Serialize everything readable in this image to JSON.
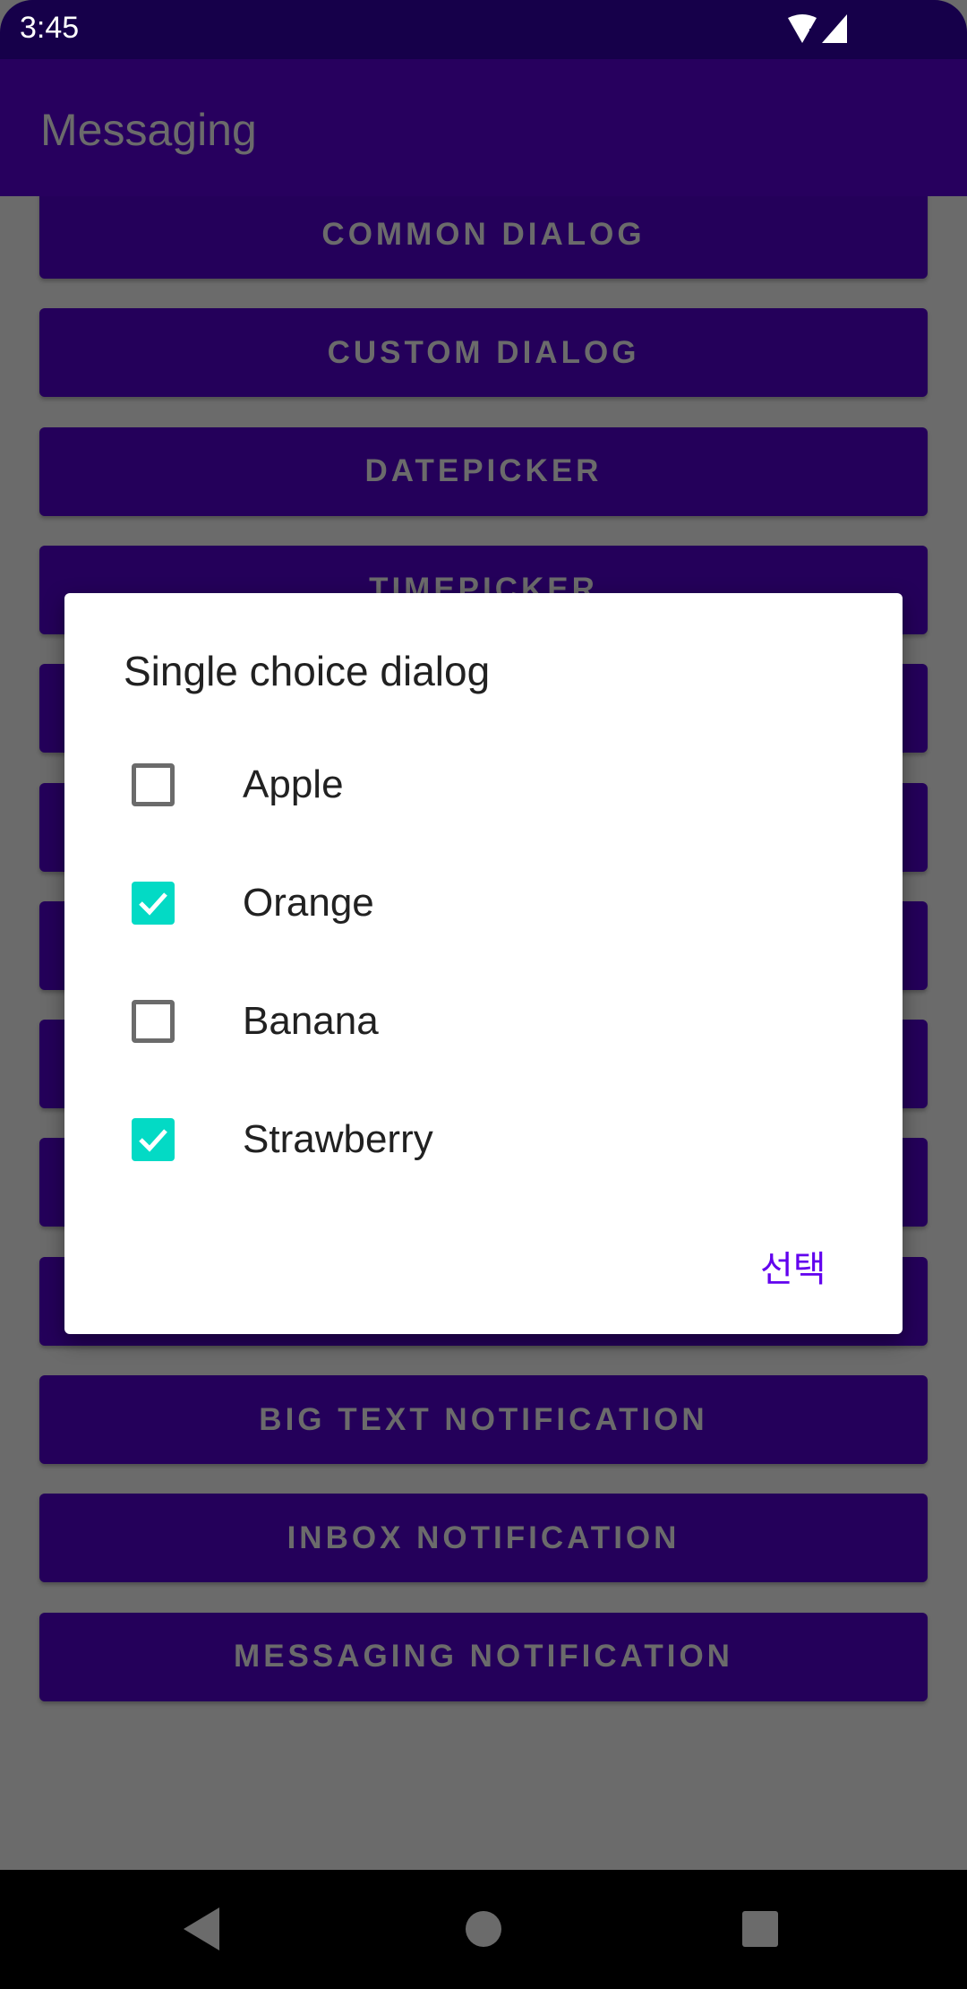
{
  "status_bar": {
    "time": "3:45"
  },
  "app_bar": {
    "title": "Messaging"
  },
  "buttons": [
    "COMMON DIALOG",
    "CUSTOM DIALOG",
    "DATEPICKER",
    "TIMEPICKER",
    "",
    "",
    "",
    "",
    "",
    "",
    "BIG TEXT NOTIFICATION",
    "INBOX NOTIFICATION",
    "MESSAGING NOTIFICATION"
  ],
  "dialog": {
    "title": "Single choice dialog",
    "items": [
      {
        "label": "Apple",
        "checked": false
      },
      {
        "label": "Orange",
        "checked": true
      },
      {
        "label": "Banana",
        "checked": false
      },
      {
        "label": "Strawberry",
        "checked": true
      }
    ],
    "action_label": "선택"
  },
  "colors": {
    "accent": "#03dac5",
    "primary": "#6200ee"
  }
}
